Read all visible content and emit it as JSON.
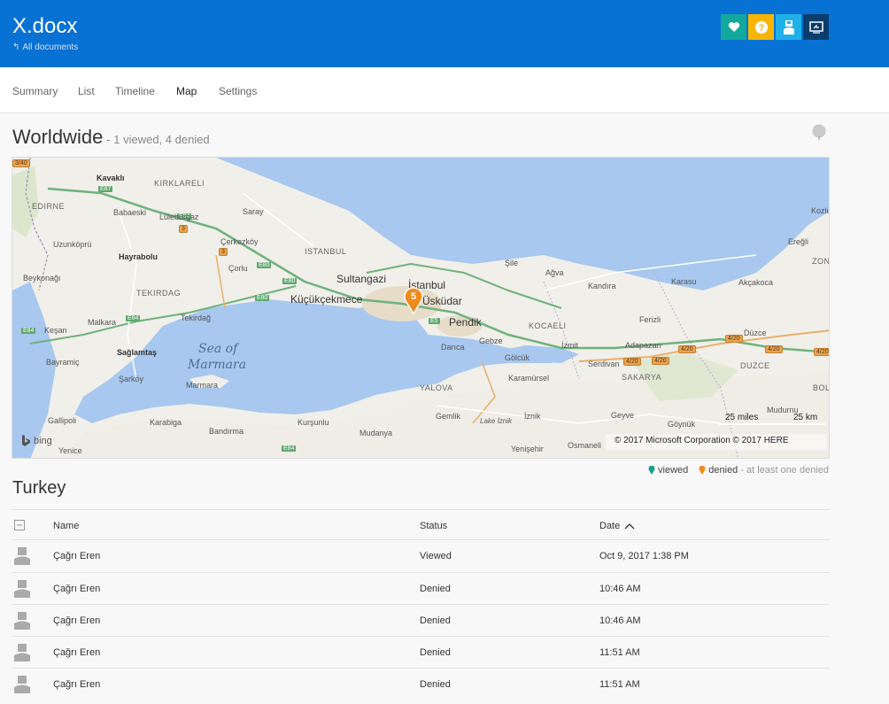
{
  "header": {
    "title": "X.docx",
    "back_label": "All documents",
    "buttons": [
      {
        "icon": "heart-icon",
        "color": "#13a89e"
      },
      {
        "icon": "help-icon",
        "color": "#f7b500"
      },
      {
        "icon": "user-icon",
        "color": "#1fb0e8"
      },
      {
        "icon": "present-icon",
        "color": "#0a3d6b"
      }
    ]
  },
  "nav": {
    "tabs": [
      {
        "label": "Summary"
      },
      {
        "label": "List"
      },
      {
        "label": "Timeline"
      },
      {
        "label": "Map",
        "active": true
      },
      {
        "label": "Settings"
      }
    ]
  },
  "worldwide": {
    "title": "Worldwide",
    "subtitle": "- 1 viewed, 4 denied"
  },
  "map": {
    "cluster_count": "5",
    "attribution": "© 2017 Microsoft Corporation   © 2017 HERE",
    "scale_miles": "25 miles",
    "scale_km": "25 km",
    "brand": "bing",
    "sea_label": [
      "Sea of",
      "Marmara"
    ],
    "labels": {
      "kirklareli": "KIRKLARELI",
      "kavakli": "Kavaklı",
      "edirne": "EDIRNE",
      "babaeski": "Babaeski",
      "luleburgaz": "Lüleburgaz",
      "saray": "Saray",
      "uzunkopru": "Uzunköprü",
      "cerkezkoy": "Çerkezköy",
      "hayrabolu": "Hayrabolu",
      "corlu": "Çorlu",
      "istanbul_prov": "ISTANBUL",
      "sultangazi": "Sultangazi",
      "istanbul": "İstanbul",
      "uskudar": "Üsküdar",
      "kucukcekmece": "Küçükçekmece",
      "beykonagi": "Beykonağı",
      "tekirdag_prov": "TEKIRDAG",
      "tekirdag": "Tekirdağ",
      "malkara": "Malkara",
      "kesan": "Keşan",
      "saglamtas": "Sağlamtaş",
      "bayramic": "Bayramiç",
      "sarkoy": "Şarköy",
      "marmara": "Marmara",
      "gallipoli": "Gallipoli",
      "karabiga": "Karabiga",
      "bandirma": "Bandırma",
      "kursunlu": "Kurşunlu",
      "mudanya": "Mudanya",
      "yenice": "Yenice",
      "pendik": "Pendik",
      "gebze": "Gebze",
      "darica": "Darıca",
      "golcuk": "Gölcük",
      "izmit": "İzmit",
      "karamursel": "Karamürsel",
      "yalova_prov": "YALOVA",
      "gemlik": "Gemlik",
      "iznik": "İznik",
      "lake_iznik": "Lake İznik",
      "yenisehir": "Yenişehir",
      "osmaneli": "Osmaneli",
      "kocaeli_prov": "KOCAELI",
      "sile": "Şile",
      "agva": "Ağva",
      "kandira": "Kandıra",
      "karasu": "Karasu",
      "akcakoca": "Akçakoca",
      "eregli": "Ereğli",
      "ferizli": "Ferizli",
      "adapazari": "Adapazarı",
      "serdivan": "Serdivan",
      "sakarya_prov": "SAKARYA",
      "duzce": "Düzce",
      "duzce_prov": "DUZCE",
      "geyve": "Geyve",
      "goynuk": "Göynük",
      "mudurnu": "Mudurnu",
      "kozlu": "Kozlu",
      "zon": "ZON",
      "bol": "BOL"
    },
    "shields": {
      "s1": "3/40",
      "s2": "3",
      "s3": "3",
      "s4": "4/20",
      "s5": "4/20",
      "s6": "4/20",
      "s7": "4/20",
      "s8": "4/20",
      "s9": "4/20"
    },
    "roads": {
      "r1": "E87",
      "r2": "E84",
      "r3": "E80",
      "r4": "E80",
      "r5": "E5",
      "r6": "E84",
      "r7": "E84",
      "r8": "E80",
      "r9": "E84"
    }
  },
  "legend": {
    "viewed": "viewed",
    "denied": "denied",
    "note": "- at least one denied",
    "viewed_color": "#1a9e8f",
    "denied_color": "#f08a1c"
  },
  "region": {
    "title": "Turkey"
  },
  "table": {
    "columns": {
      "name": "Name",
      "status": "Status",
      "date": "Date"
    },
    "rows": [
      {
        "name": "Çağrı Eren",
        "status": "Viewed",
        "date": "Oct 9, 2017 1:38 PM"
      },
      {
        "name": "Çağrı Eren",
        "status": "Denied",
        "date": "10:46 AM"
      },
      {
        "name": "Çağrı Eren",
        "status": "Denied",
        "date": "10:46 AM"
      },
      {
        "name": "Çağrı Eren",
        "status": "Denied",
        "date": "11:51 AM"
      },
      {
        "name": "Çağrı Eren",
        "status": "Denied",
        "date": "11:51 AM"
      }
    ]
  }
}
